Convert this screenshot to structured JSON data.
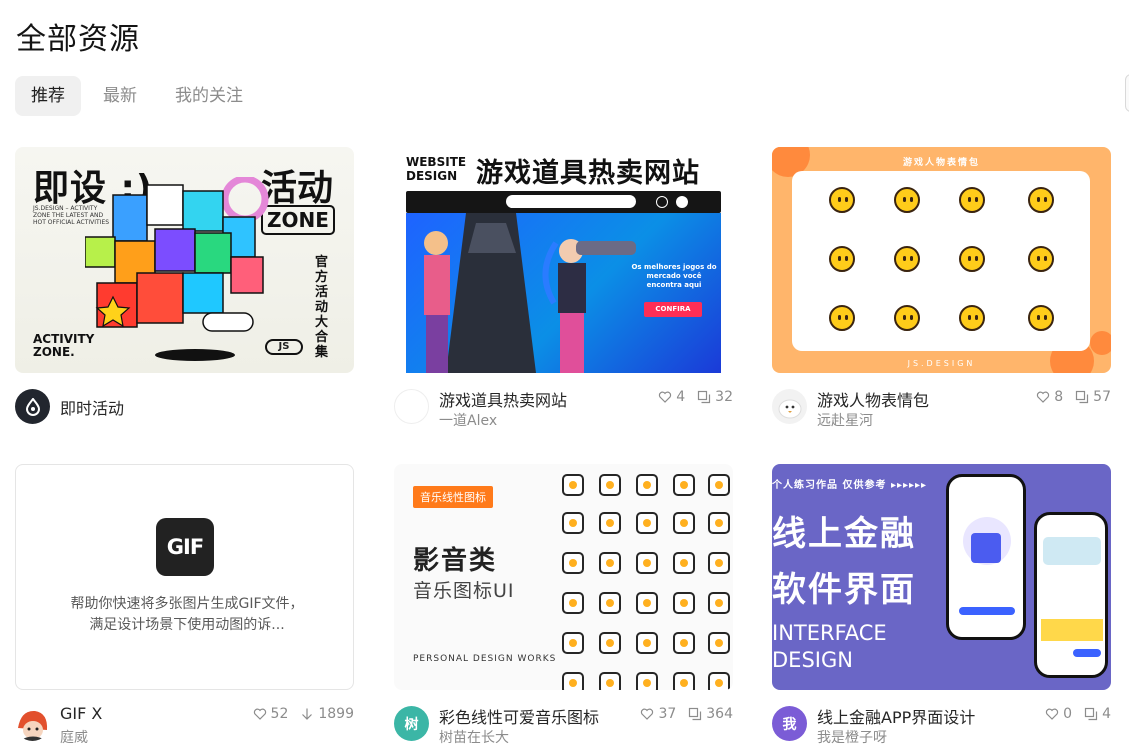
{
  "page_title": "全部资源",
  "tabs": [
    {
      "label": "推荐",
      "active": true
    },
    {
      "label": "最新",
      "active": false
    },
    {
      "label": "我的关注",
      "active": false
    }
  ],
  "cards": [
    {
      "title": "即时活动",
      "author": "",
      "stats": [],
      "thumb": {
        "line1": "即设 :)",
        "line2": "活动",
        "zone": "ZONE",
        "vertical": "官方活动大合集",
        "small": "JS.DESIGN – ACTIVITY ZONE THE LATEST AND HOT OFFICIAL ACTIVITIES",
        "activity": "ACTIVITY ZONE.",
        "js": "JS"
      }
    },
    {
      "title": "游戏道具热卖网站",
      "author": "一道Alex",
      "stats": [
        {
          "icon": "heart-icon",
          "value": "4"
        },
        {
          "icon": "comment-icon",
          "value": "32"
        }
      ],
      "thumb": {
        "tag": "WEBSITE DESIGN",
        "headline": "游戏道具热卖网站",
        "promo": "Os melhores jogos do mercado você encontra aqui",
        "cta": "CONFIRA"
      }
    },
    {
      "title": "游戏人物表情包",
      "author": "远赴星河",
      "stats": [
        {
          "icon": "heart-icon",
          "value": "8"
        },
        {
          "icon": "comment-icon",
          "value": "57"
        }
      ],
      "thumb": {
        "header": "游戏人物表情包",
        "footer": "JS.DESIGN"
      }
    },
    {
      "title": "GIF X",
      "author": "庭威",
      "stats": [
        {
          "icon": "heart-icon",
          "value": "52"
        },
        {
          "icon": "download-icon",
          "value": "1899"
        }
      ],
      "thumb": {
        "logo": "GIF",
        "description": "帮助你快速将多张图片生成GIF文件，满足设计场景下使用动图的诉..."
      }
    },
    {
      "title": "彩色线性可爱音乐图标",
      "author": "树苗在长大",
      "avatar_text": "树",
      "stats": [
        {
          "icon": "heart-icon",
          "value": "37"
        },
        {
          "icon": "comment-icon",
          "value": "364"
        }
      ],
      "thumb": {
        "tag": "音乐线性图标",
        "h1": "影音类",
        "h2": "音乐图标UI",
        "footer": "PERSONAL  DESIGN WORKS"
      }
    },
    {
      "title": "线上金融APP界面设计",
      "author": "我是橙子呀",
      "avatar_text": "我",
      "stats": [
        {
          "icon": "heart-icon",
          "value": "0"
        },
        {
          "icon": "comment-icon",
          "value": "4"
        }
      ],
      "thumb": {
        "top": "个人练习作品  仅供参考  ▸▸▸▸▸▸",
        "b1": "线上金融",
        "b2": "软件界面",
        "en1": "INTERFACE",
        "en2": "DESIGN"
      }
    }
  ],
  "colors": {
    "tab_active_bg": "#f0f0f0",
    "muted": "#8c8c8c",
    "finance_bg": "#6a66c6",
    "emoji_bg": "#ffb56b",
    "tree_avatar": "#3bb6a6",
    "me_avatar": "#7b5cd6"
  }
}
